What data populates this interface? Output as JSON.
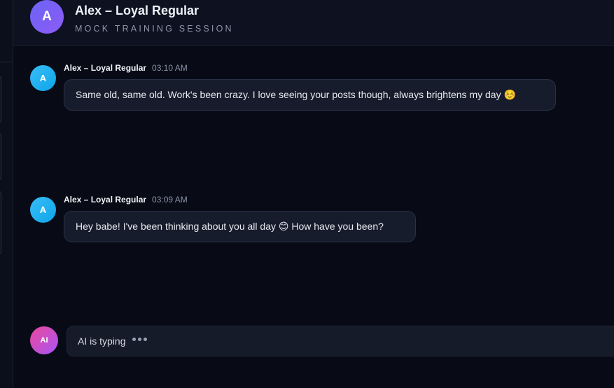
{
  "header": {
    "avatar_initial": "A",
    "title": "Alex – Loyal Regular",
    "subtitle": "MOCK TRAINING SESSION"
  },
  "messages": [
    {
      "avatar_initial": "A",
      "sender": "Alex – Loyal Regular",
      "time": "03:10 AM",
      "text": "Same old, same old. Work's been crazy. I love seeing your posts though, always brightens my day ☺️"
    },
    {
      "avatar_initial": "A",
      "sender": "Alex – Loyal Regular",
      "time": "03:09 AM",
      "text": "Hey babe! I've been thinking about you all day 😊 How have you been?"
    }
  ],
  "typing": {
    "avatar_label": "AI",
    "text": "AI is typing"
  },
  "colors": {
    "background": "#080b16",
    "header_avatar": "#7c5cf6",
    "contact_avatar": "#0ea5e9",
    "ai_avatar": "#d946ef"
  }
}
